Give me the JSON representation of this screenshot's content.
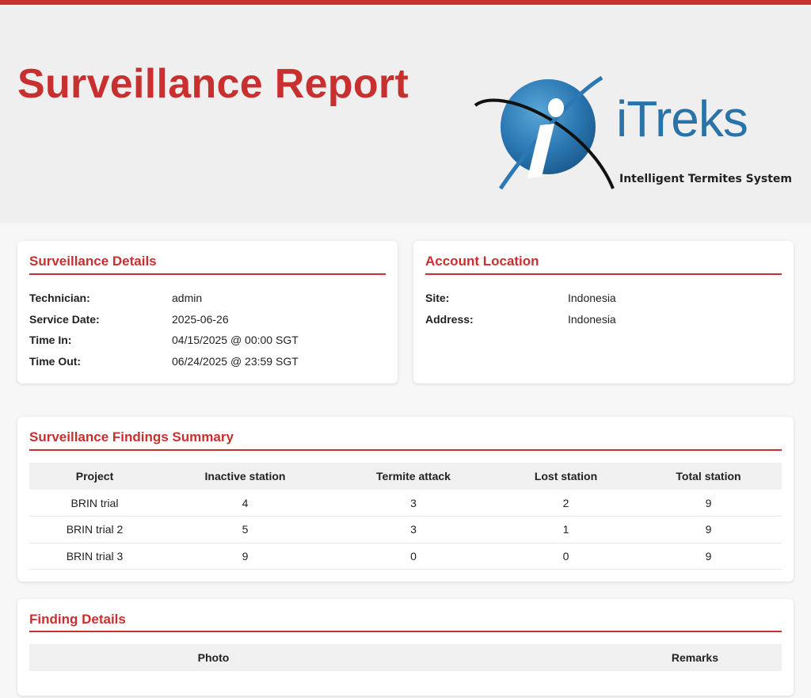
{
  "header": {
    "title": "Surveillance Report",
    "logo_text": "iTreks",
    "logo_tagline": "Intelligent Termites System"
  },
  "surveillance_details": {
    "title": "Surveillance Details",
    "rows": [
      {
        "label": "Technician:",
        "value": "admin"
      },
      {
        "label": "Service Date:",
        "value": "2025-06-26"
      },
      {
        "label": "Time In:",
        "value": "04/15/2025 @ 00:00 SGT"
      },
      {
        "label": "Time Out:",
        "value": "06/24/2025 @ 23:59 SGT"
      }
    ]
  },
  "account_location": {
    "title": "Account Location",
    "rows": [
      {
        "label": "Site:",
        "value": "Indonesia"
      },
      {
        "label": "Address:",
        "value": "Indonesia"
      }
    ]
  },
  "findings_summary": {
    "title": "Surveillance Findings Summary",
    "columns": [
      "Project",
      "Inactive station",
      "Termite attack",
      "Lost station",
      "Total station"
    ],
    "rows": [
      [
        "BRIN trial",
        "4",
        "3",
        "2",
        "9"
      ],
      [
        "BRIN trial 2",
        "5",
        "3",
        "1",
        "9"
      ],
      [
        "BRIN trial 3",
        "9",
        "0",
        "0",
        "9"
      ]
    ]
  },
  "finding_details": {
    "title": "Finding Details",
    "columns": [
      "Photo",
      "Remarks"
    ]
  },
  "colors": {
    "accent": "#c8302f",
    "logo_blue": "#2a73a8",
    "header_bg": "#efefef"
  }
}
